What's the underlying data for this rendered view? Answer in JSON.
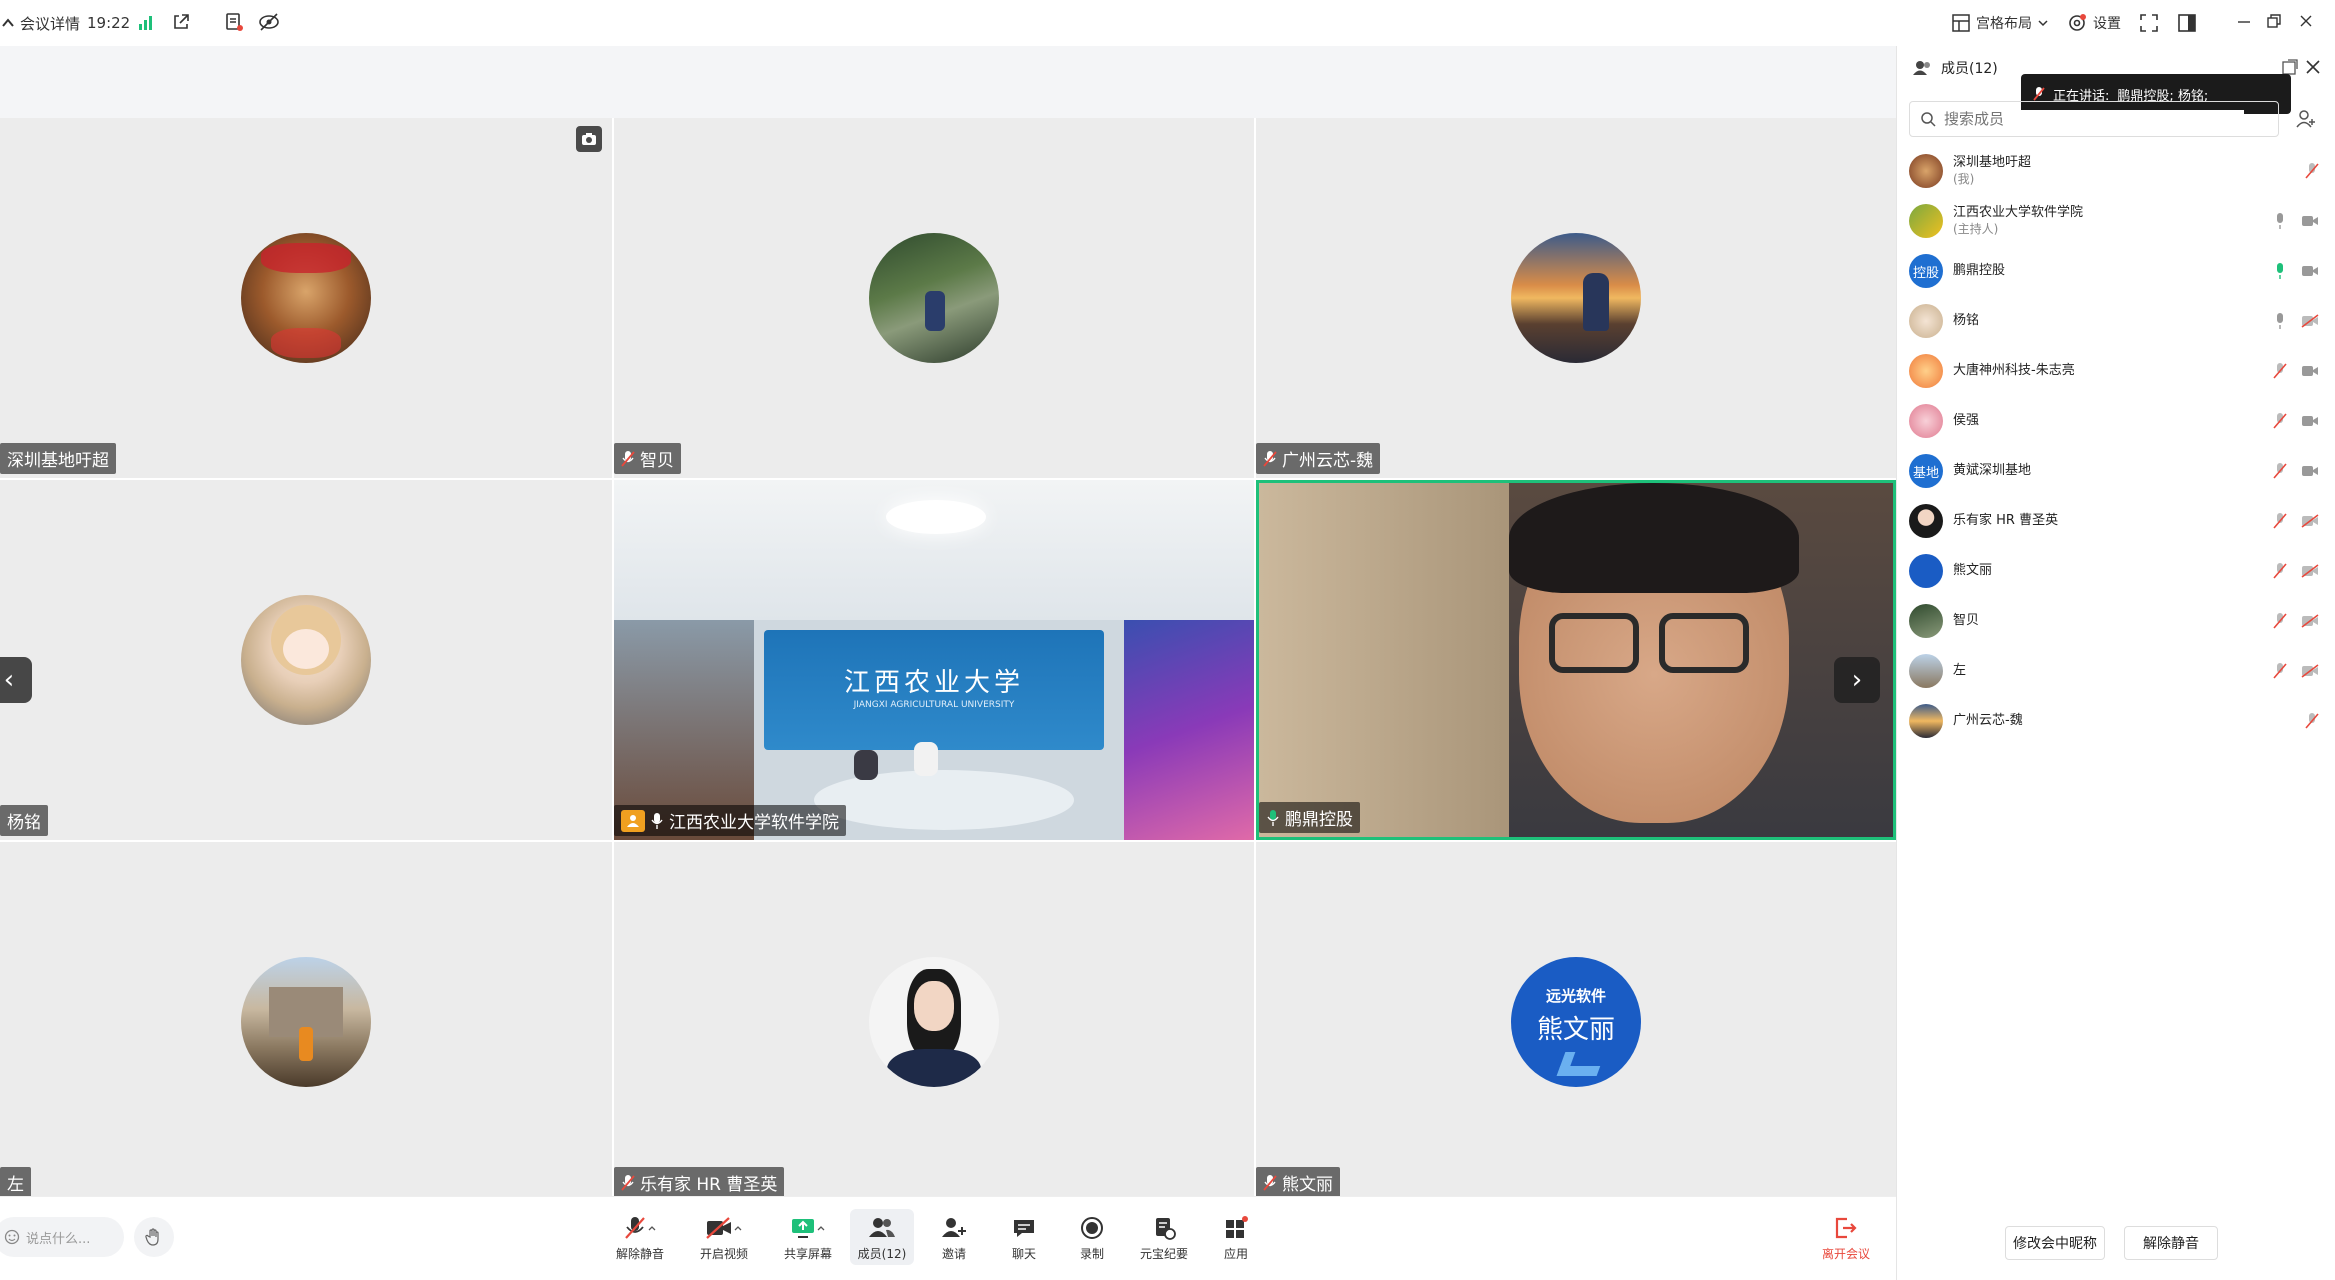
{
  "topbar": {
    "meeting_info": "会议详情",
    "time": "19:22",
    "layout": "宫格布局",
    "settings": "设置"
  },
  "tiles": [
    {
      "name": "深圳基地吁超",
      "muted_icon": false
    },
    {
      "name": "智贝",
      "muted_icon": true
    },
    {
      "name": "广州云芯-魏",
      "muted_icon": true
    },
    {
      "name": "杨铭",
      "muted_icon": false
    },
    {
      "name": "江西农业大学软件学院",
      "muted_icon": false
    },
    {
      "name": "鹏鼎控股",
      "muted_icon": false
    },
    {
      "name": "左",
      "muted_icon": false
    },
    {
      "name": "乐有家 HR 曹圣英",
      "muted_icon": true
    },
    {
      "name": "熊文丽",
      "muted_icon": true
    }
  ],
  "room_sign": "江西农业大学",
  "room_sign_sub": "JIANGXI AGRICULTURAL UNIVERSITY",
  "avatar_logo": {
    "brand": "远光软件",
    "name": "熊文丽"
  },
  "panel": {
    "title": "成员(12)",
    "speaking_label": "正在讲话:",
    "speaking_names": "鹏鼎控股; 杨铭;",
    "search_placeholder": "搜索成员",
    "members": [
      {
        "name": "深圳基地吁超",
        "sub": "(我)",
        "avatar_text": ""
      },
      {
        "name": "江西农业大学软件学院",
        "sub": "(主持人)",
        "avatar_text": ""
      },
      {
        "name": "鹏鼎控股",
        "sub": "",
        "avatar_text": "控股"
      },
      {
        "name": "杨铭",
        "sub": "",
        "avatar_text": ""
      },
      {
        "name": "大唐神州科技-朱志亮",
        "sub": "",
        "avatar_text": ""
      },
      {
        "name": "侯强",
        "sub": "",
        "avatar_text": ""
      },
      {
        "name": "黄斌深圳基地",
        "sub": "",
        "avatar_text": "基地"
      },
      {
        "name": "乐有家 HR 曹圣英",
        "sub": "",
        "avatar_text": ""
      },
      {
        "name": "熊文丽",
        "sub": "",
        "avatar_text": ""
      },
      {
        "name": "智贝",
        "sub": "",
        "avatar_text": ""
      },
      {
        "name": "左",
        "sub": "",
        "avatar_text": ""
      },
      {
        "name": "广州云芯-魏",
        "sub": "",
        "avatar_text": ""
      }
    ],
    "rename_button": "修改会中昵称",
    "unmute_all_button": "解除静音"
  },
  "bottombar": {
    "chat_placeholder": "说点什么...",
    "tools": [
      "解除静音",
      "开启视频",
      "共享屏幕",
      "成员(12)",
      "邀请",
      "聊天",
      "录制",
      "元宝纪要",
      "应用"
    ],
    "leave": "离开会议"
  },
  "colors": {
    "accent": "#1ec07a",
    "danger": "#e8483c",
    "blue": "#1f6fd1"
  }
}
